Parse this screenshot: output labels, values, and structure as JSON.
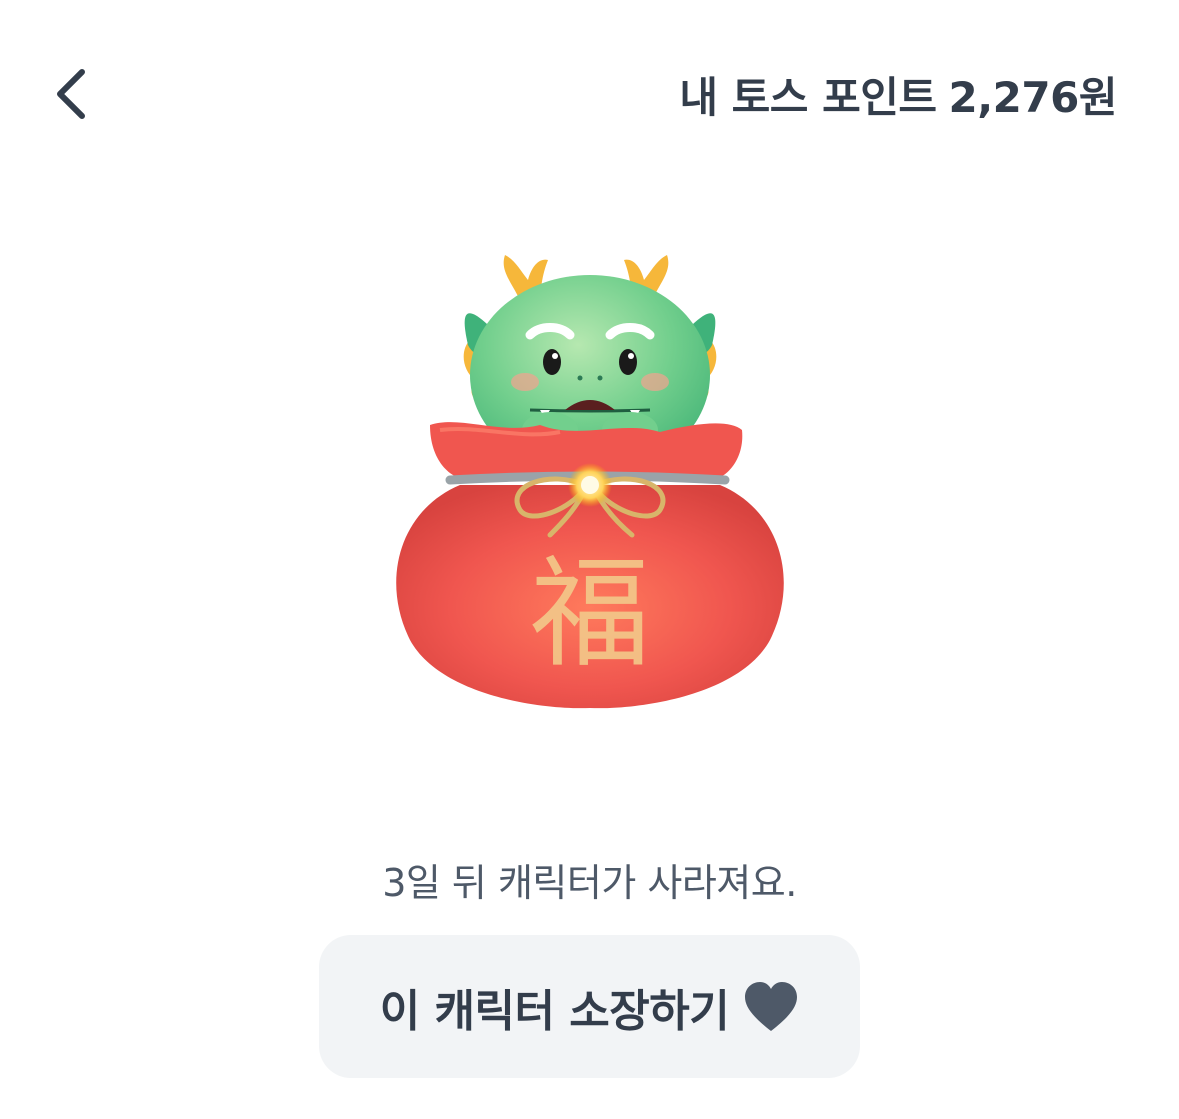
{
  "header": {
    "back_icon": "chevron-left-icon",
    "points_label": "내 토스 포인트",
    "points_value": "2,276원"
  },
  "character": {
    "emblem_text": "福",
    "colors": {
      "bag_red": "#f0564f",
      "dragon_green": "#5cc68a",
      "horn_yellow": "#f6b73a",
      "gold_string": "#d8b56a"
    }
  },
  "notice": {
    "text": "3일 뒤 캐릭터가 사라져요."
  },
  "keep_button": {
    "label": "이 캐릭터 소장하기",
    "icon": "heart-icon",
    "background": "#f2f4f6"
  }
}
